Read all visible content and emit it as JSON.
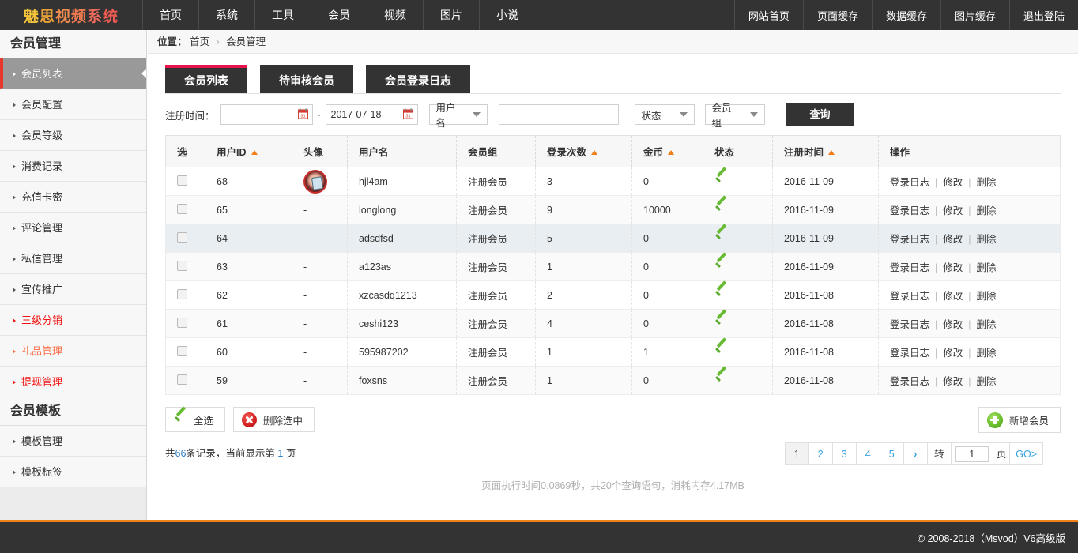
{
  "topnav": {
    "logo_chars": [
      "魅",
      "思",
      "视",
      "频",
      "系",
      "统"
    ],
    "left_items": [
      {
        "label": "首页",
        "name": "nav-home"
      },
      {
        "label": "系统",
        "name": "nav-system"
      },
      {
        "label": "工具",
        "name": "nav-tools"
      },
      {
        "label": "会员",
        "name": "nav-member"
      },
      {
        "label": "视频",
        "name": "nav-video"
      },
      {
        "label": "图片",
        "name": "nav-image"
      },
      {
        "label": "小说",
        "name": "nav-novel"
      }
    ],
    "right_items": [
      {
        "label": "网站首页",
        "name": "nav-site-home"
      },
      {
        "label": "页面缓存",
        "name": "nav-page-cache"
      },
      {
        "label": "数据缓存",
        "name": "nav-data-cache"
      },
      {
        "label": "图片缓存",
        "name": "nav-image-cache"
      },
      {
        "label": "退出登陆",
        "name": "nav-logout"
      }
    ]
  },
  "sidebar": {
    "group1_title": "会员管理",
    "group1_items": [
      {
        "label": "会员列表",
        "state": "active"
      },
      {
        "label": "会员配置",
        "state": "normal"
      },
      {
        "label": "会员等级",
        "state": "normal"
      },
      {
        "label": "消费记录",
        "state": "normal"
      },
      {
        "label": "充值卡密",
        "state": "normal"
      },
      {
        "label": "评论管理",
        "state": "normal"
      },
      {
        "label": "私信管理",
        "state": "normal"
      },
      {
        "label": "宣传推广",
        "state": "normal"
      },
      {
        "label": "三级分销",
        "state": "red"
      },
      {
        "label": "礼品管理",
        "state": "orange"
      },
      {
        "label": "提现管理",
        "state": "red"
      }
    ],
    "group2_title": "会员模板",
    "group2_items": [
      {
        "label": "模板管理",
        "state": "normal"
      },
      {
        "label": "模板标签",
        "state": "normal"
      }
    ]
  },
  "breadcrumb": {
    "prefix": "位置：",
    "root": "首页",
    "separator": "›",
    "current": "会员管理"
  },
  "tabs": [
    {
      "label": "会员列表",
      "active": true
    },
    {
      "label": "待审核会员",
      "active": false
    },
    {
      "label": "会员登录日志",
      "active": false
    }
  ],
  "filter": {
    "date_label": "注册时间：",
    "date_from_value": "",
    "date_from_placeholder": "",
    "date_to_value": "2017-07-18",
    "dash": "-",
    "field_select": "用户名",
    "keyword_value": "",
    "keyword_placeholder": "",
    "status_select": "状态",
    "group_select": "会员组",
    "query_button": "查询",
    "calendar_icon": "calendar-icon"
  },
  "table": {
    "columns": [
      {
        "label": "选",
        "sortable": false
      },
      {
        "label": "用户ID",
        "sortable": true
      },
      {
        "label": "头像",
        "sortable": false
      },
      {
        "label": "用户名",
        "sortable": false
      },
      {
        "label": "会员组",
        "sortable": false
      },
      {
        "label": "登录次数",
        "sortable": true
      },
      {
        "label": "金币",
        "sortable": true
      },
      {
        "label": "状态",
        "sortable": false
      },
      {
        "label": "注册时间",
        "sortable": true
      },
      {
        "label": "操作",
        "sortable": false
      }
    ],
    "ops": {
      "log": "登录日志",
      "edit": "修改",
      "delete": "删除",
      "bar": "|"
    },
    "status_icon": "green-check-icon",
    "rows": [
      {
        "id": "68",
        "avatar": "image",
        "avatar_text": "",
        "username": "hjl4am",
        "group": "注册会员",
        "logins": "3",
        "coins": "0",
        "status": "ok",
        "regtime": "2016-11-09",
        "highlight": "none"
      },
      {
        "id": "65",
        "avatar": "none",
        "avatar_text": "-",
        "username": "longlong",
        "group": "注册会员",
        "logins": "9",
        "coins": "10000",
        "status": "ok",
        "regtime": "2016-11-09",
        "highlight": "alt"
      },
      {
        "id": "64",
        "avatar": "none",
        "avatar_text": "-",
        "username": "adsdfsd",
        "group": "注册会员",
        "logins": "5",
        "coins": "0",
        "status": "ok",
        "regtime": "2016-11-09",
        "highlight": "hover"
      },
      {
        "id": "63",
        "avatar": "none",
        "avatar_text": "-",
        "username": "a123as",
        "group": "注册会员",
        "logins": "1",
        "coins": "0",
        "status": "ok",
        "regtime": "2016-11-09",
        "highlight": "alt"
      },
      {
        "id": "62",
        "avatar": "none",
        "avatar_text": "-",
        "username": "xzcasdq1213",
        "group": "注册会员",
        "logins": "2",
        "coins": "0",
        "status": "ok",
        "regtime": "2016-11-08",
        "highlight": "none"
      },
      {
        "id": "61",
        "avatar": "none",
        "avatar_text": "-",
        "username": "ceshi123",
        "group": "注册会员",
        "logins": "4",
        "coins": "0",
        "status": "ok",
        "regtime": "2016-11-08",
        "highlight": "alt"
      },
      {
        "id": "60",
        "avatar": "none",
        "avatar_text": "-",
        "username": "595987202",
        "group": "注册会员",
        "logins": "1",
        "coins": "1",
        "status": "ok",
        "regtime": "2016-11-08",
        "highlight": "none"
      },
      {
        "id": "59",
        "avatar": "none",
        "avatar_text": "-",
        "username": "foxsns",
        "group": "注册会员",
        "logins": "1",
        "coins": "0",
        "status": "ok",
        "regtime": "2016-11-08",
        "highlight": "alt"
      }
    ]
  },
  "actions": {
    "select_all": "全选",
    "delete_selected": "删除选中",
    "add_member": "新增会员",
    "select_all_icon": "green-check-icon",
    "delete_icon": "red-x-circle-icon",
    "add_icon": "green-plus-circle-icon"
  },
  "summary": {
    "prefix": "共",
    "total": "66",
    "middle": "条记录，当前显示第",
    "page": "1",
    "suffix": "页"
  },
  "pager": {
    "pages": [
      "1",
      "2",
      "3",
      "4",
      "5"
    ],
    "current": "1",
    "next": "›",
    "jump_label": "转",
    "jump_value": "1",
    "page_unit": "页",
    "go": "GO>"
  },
  "exec_info": "页面执行时间0.0869秒，共20个查询语句，消耗内存4.17MB",
  "footer": {
    "copyright": "© 2008-2018（Msvod）V6高级版"
  },
  "colors": {
    "navbar": "#333333",
    "accent_orange": "#f08019",
    "tab_active": "#e8134e",
    "link_blue": "#36a3e0",
    "sidebar_red": "#f21313",
    "sidebar_orange": "#f9704b",
    "status_green": "#66bb33"
  }
}
